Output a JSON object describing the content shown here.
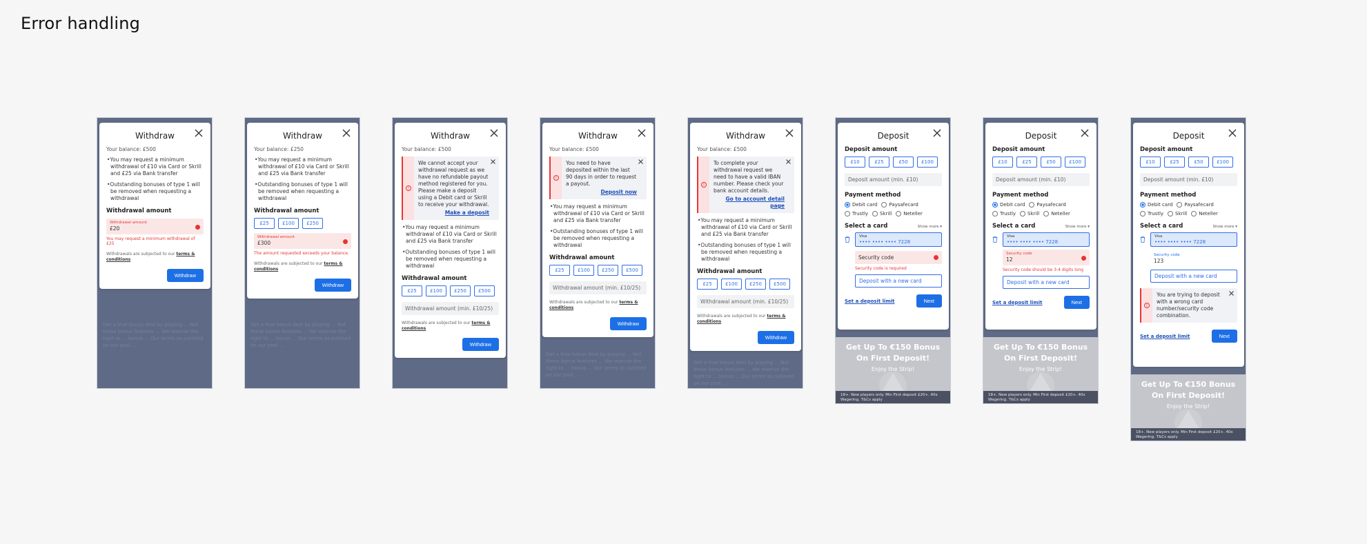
{
  "page_title": "Error handling",
  "common": {
    "withdraw_title": "Withdraw",
    "deposit_title": "Deposit",
    "bullet1": "•You may request a minimum withdrawal of £10 via Card or Skrill and £25 via Bank transfer",
    "bullet2": "•Outstanding bonuses of type 1 will be removed when requesting a withdrawal",
    "withdrawal_amount": "Withdrawal amount",
    "terms_prefix": "Withdrawals are subjected to our ",
    "terms_link": "terms & conditions",
    "withdraw_btn": "Withdraw",
    "backdrop_text": "Get a true bonus deal by playing ... Not these bonus features ... We reserve the right to ... bonus ... Our terms as outlined on our pool ...",
    "deposit_amount": "Deposit amount",
    "deposit_placeholder": "Deposit amount (min. £10)",
    "payment_method": "Payment method",
    "methods": [
      "Debit card",
      "Paysafecard",
      "Trustly",
      "Skrill",
      "Neteller"
    ],
    "select_card": "Select a card",
    "show_more": "Show more ▾",
    "card_brand": "Visa",
    "card_number": "•••• •••• •••• 7228",
    "security_code": "Security code",
    "new_card": "Deposit with a new card",
    "deposit_limit": "Set a deposit limit",
    "next_btn": "Next",
    "promo_line1": "Get Up To €150 Bonus",
    "promo_line2": "On First Deposit!",
    "promo_line3": "Enjoy the Strip!",
    "promo_foot": "18+. New players only. Min First deposit £20+. 40x Wagering. T&Cs apply",
    "chips_withdraw": [
      "£25",
      "£100",
      "£250",
      "£500"
    ],
    "chips_withdraw_short": [
      "£25",
      "£100",
      "£250"
    ],
    "chips_deposit": [
      "£10",
      "£25",
      "£50",
      "£100"
    ],
    "withdraw_placeholder": "Withdrawal amount (min. £10/25)"
  },
  "screens": {
    "s1": {
      "balance": "Your balance: £500",
      "field_label": "Withdrawal amount",
      "field_value": "£20",
      "error": "You may request a minimum withdrawal of £25"
    },
    "s2": {
      "balance": "Your balance: £250",
      "field_label": "Withdrawal amount",
      "field_value": "£300",
      "error": "The amount requested exceeds your balance."
    },
    "s3": {
      "balance": "Your balance: £500",
      "alert": "We cannot accept your withdrawal request as we have no refundable payout method registered for you. Please make a deposit using a Debit card or Skrill to receive your withdrawal.",
      "alert_link": "Make a deposit"
    },
    "s4": {
      "balance": "Your balance: £500",
      "alert": "You need to have deposited within the last 90 days in order to request a payout.",
      "alert_link": "Deposit now"
    },
    "s5": {
      "balance": "Your balance: £500",
      "alert": "To complete your withdrawal request we need to have a valid IBAN number. Please check your bank account details.",
      "alert_link": "Go to account detail page"
    },
    "s6": {
      "error": "Security code is required"
    },
    "s7": {
      "field_value": "12",
      "error": "Security code should be 3-4 digits long"
    },
    "s8": {
      "field_value": "123",
      "alert": "You are trying to deposit with a wrong card number/security code combination."
    }
  }
}
